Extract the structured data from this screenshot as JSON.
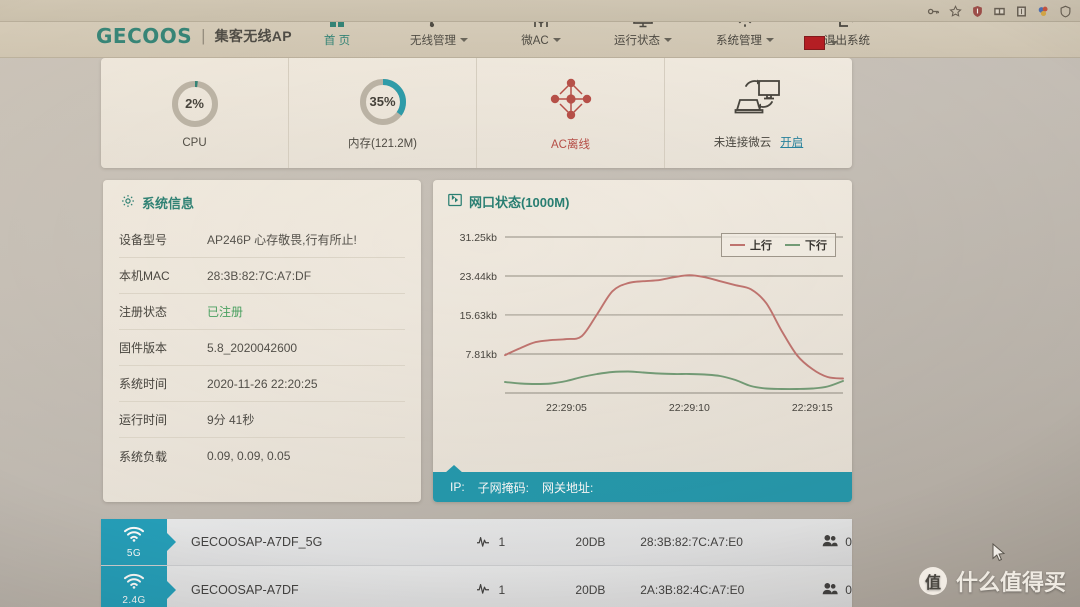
{
  "browser": {
    "extension_icons": [
      "key-icon",
      "star-icon",
      "shield-icon",
      "wallet-icon",
      "translate-icon",
      "colors-icon",
      "umbrella-icon"
    ]
  },
  "header": {
    "logo": "GECOOS",
    "divider": "|",
    "subtitle": "集客无线AP",
    "language_icon": "china-flag-icon",
    "nav": [
      {
        "label": "首 页",
        "icon": "home-icon",
        "has_caret": false,
        "active": true
      },
      {
        "label": "无线管理",
        "icon": "wifi-signal-icon",
        "has_caret": true,
        "active": false
      },
      {
        "label": "微AC",
        "icon": "sliders-icon",
        "has_caret": true,
        "active": false
      },
      {
        "label": "运行状态",
        "icon": "monitor-icon",
        "has_caret": true,
        "active": false
      },
      {
        "label": "系统管理",
        "icon": "gear-icon",
        "has_caret": true,
        "active": false
      },
      {
        "label": "退出系统",
        "icon": "logout-icon",
        "has_caret": false,
        "active": false
      }
    ]
  },
  "stats": {
    "cpu": {
      "value": "2%",
      "percent": 2,
      "caption": "CPU",
      "color": "#1d7a6e"
    },
    "memory": {
      "value": "35%",
      "percent": 35,
      "caption": "内存(121.2M)",
      "color": "#1b97a8"
    },
    "ac": {
      "caption": "AC离线",
      "icon": "network-nodes-icon",
      "color": "#b4453f"
    },
    "cloud": {
      "caption": "未连接微云",
      "action_label": "开启",
      "icon": "cloud-sync-icon"
    }
  },
  "sysinfo": {
    "title": "系统信息",
    "title_icon": "gear-icon",
    "rows": [
      {
        "key": "设备型号",
        "value": "AP246P 心存敬畏,行有所止!",
        "status": ""
      },
      {
        "key": "本机MAC",
        "value": "28:3B:82:7C:A7:DF",
        "status": ""
      },
      {
        "key": "注册状态",
        "value": "已注册",
        "status": "ok"
      },
      {
        "key": "固件版本",
        "value": "5.8_2020042600",
        "status": ""
      },
      {
        "key": "系统时间",
        "value": "2020-11-26 22:20:25",
        "status": ""
      },
      {
        "key": "运行时间",
        "value": "9分 41秒",
        "status": ""
      },
      {
        "key": "系统负载",
        "value": "0.09, 0.09, 0.05",
        "status": ""
      }
    ]
  },
  "netchart": {
    "title": "网口状态(1000M)",
    "title_icon": "ethernet-port-icon",
    "ip_bar": {
      "ip_label": "IP:",
      "mask_label": "子网掩码:",
      "gateway_label": "网关地址:"
    }
  },
  "chart_data": {
    "type": "line",
    "title": "网口状态(1000M)",
    "xlabel": "",
    "ylabel": "",
    "ylim": [
      0,
      31.25
    ],
    "yticks": [
      7.81,
      15.63,
      23.44,
      31.25
    ],
    "ytick_labels": [
      "7.81kb",
      "15.63kb",
      "23.44kb",
      "31.25kb"
    ],
    "x": [
      0,
      1,
      2,
      3,
      4,
      5,
      6,
      7,
      8,
      9,
      10,
      11,
      12,
      13,
      14,
      15,
      16,
      17,
      18,
      19,
      20,
      21,
      22
    ],
    "xticks": [
      4,
      12,
      20
    ],
    "xtick_labels": [
      "22:29:05",
      "22:29:10",
      "22:29:15"
    ],
    "grid": true,
    "legend_position": "top-right",
    "series": [
      {
        "name": "上行",
        "color": "#c0706c",
        "values": [
          7.6,
          9.0,
          10.2,
          10.6,
          10.8,
          11.4,
          15.8,
          20.4,
          22.0,
          22.4,
          22.6,
          23.2,
          23.6,
          23.2,
          22.4,
          21.6,
          20.8,
          18.0,
          12.5,
          7.6,
          4.8,
          3.2,
          2.9
        ]
      },
      {
        "name": "下行",
        "color": "#6f9b74",
        "values": [
          2.2,
          1.9,
          1.8,
          1.9,
          2.4,
          3.2,
          3.8,
          4.2,
          4.3,
          4.1,
          3.9,
          3.8,
          3.8,
          3.7,
          3.4,
          2.6,
          1.4,
          0.9,
          0.8,
          0.8,
          0.9,
          1.3,
          2.4
        ]
      }
    ],
    "series2_tail": [
      2.9,
      3.4,
      4.6
    ]
  },
  "ssid_list": [
    {
      "band": "5G",
      "band_icon": "wifi-icon",
      "name": "GECOOSAP-A7DF_5G",
      "channel_icon": "signal-icon",
      "channel": "1",
      "power": "20DB",
      "mac": "28:3B:82:7C:A7:E0",
      "users_icon": "users-icon",
      "users": "0"
    },
    {
      "band": "2.4G",
      "band_icon": "wifi-icon",
      "name": "GECOOSAP-A7DF",
      "channel_icon": "signal-icon",
      "channel": "1",
      "power": "20DB",
      "mac": "2A:3B:82:4C:A7:E0",
      "users_icon": "users-icon",
      "users": "0"
    }
  ],
  "watermark": {
    "badge": "值",
    "text": "什么值得买"
  }
}
